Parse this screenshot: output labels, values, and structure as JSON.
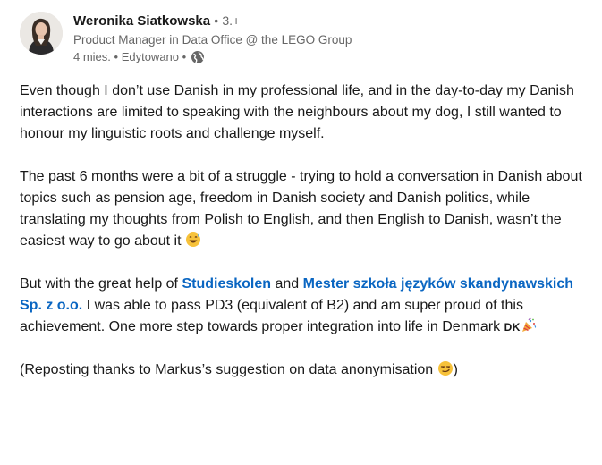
{
  "author": {
    "name": "Weronika Siatkowska",
    "bullet": "•",
    "degree": "3.+",
    "headline": "Product Manager in Data Office @ the LEGO Group",
    "time": "4 mies.",
    "edited": "Edytowano",
    "visibility_icon": "globe-icon"
  },
  "post": {
    "p1": "Even though I don’t use Danish in my professional life, and in the day-to-day my Danish interactions are limited to speaking with the neighbours about my dog, I still wanted to honour my linguistic roots and challenge myself.",
    "p2": "The past 6 months were a bit of a struggle - trying to hold a conversation in Danish about topics such as pension age, freedom in Danish society and Danish politics, while translating my thoughts from Polish to English, and then English to Danish, wasn’t the easiest way to go about it",
    "p2_emoji": "grinning-sweat-emoji",
    "p3_prefix": "But with the great help of",
    "mention1": "Studieskolen",
    "p3_and": "and",
    "mention2": "Mester szkoła języków skandynawskich Sp. z o.o.",
    "p3_rest": "I was able to pass PD3 (equivalent of B2) and am super proud of this achievement. One more step towards proper integration into life in Denmark",
    "flag": "DK",
    "p3_emoji": "party-popper-emoji",
    "p4_prefix": "(Reposting thanks to Markus’s suggestion on data anonymisation",
    "p4_emoji": "smirk-emoji",
    "p4_suffix": ")"
  },
  "colors": {
    "link": "#0a66c2",
    "text": "#191919",
    "secondary": "#666666"
  }
}
